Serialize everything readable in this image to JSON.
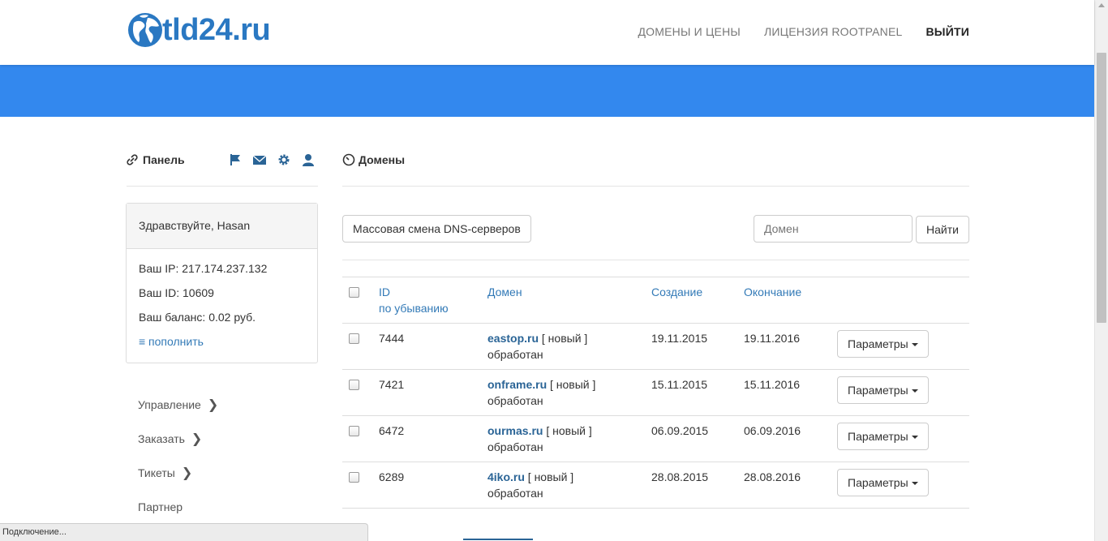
{
  "header": {
    "logo_text": "tld24.ru",
    "nav": [
      {
        "label": "ДОМЕНЫ И ЦЕНЫ",
        "active": false
      },
      {
        "label": "ЛИЦЕНЗИЯ ROOTPANEL",
        "active": false
      },
      {
        "label": "ВЫЙТИ",
        "active": true
      }
    ]
  },
  "colors": {
    "hero": "#3388ee",
    "brand": "#2a78c2",
    "link": "#337ab7"
  },
  "panel": {
    "title": "Панель",
    "icons": [
      "flag-icon",
      "envelope-icon",
      "gear-icon",
      "user-icon"
    ],
    "welcome": "Здравствуйте, Hasan",
    "ip": "Ваш IP: 217.174.237.132",
    "id": "Ваш ID: 10609",
    "balance": "Ваш баланс: 0.02 руб.",
    "topup": "≡ пополнить",
    "menu": [
      {
        "label": "Управление",
        "chevron": true
      },
      {
        "label": "Заказать",
        "chevron": true
      },
      {
        "label": "Тикеты",
        "chevron": true
      },
      {
        "label": "Партнер",
        "chevron": false
      }
    ]
  },
  "main": {
    "title": "Домены",
    "mass_dns_button": "Массовая смена DNS-серверов",
    "search": {
      "placeholder": "Домен",
      "button": "Найти"
    },
    "table": {
      "headers": {
        "id": "ID",
        "id_sort": "по убыванию",
        "domain": "Домен",
        "created": "Создание",
        "expires": "Окончание"
      },
      "rows": [
        {
          "id": "7444",
          "domain": "eastop.ru",
          "status": " [ новый ]",
          "state": "обработан",
          "created": "19.11.2015",
          "expires": "19.11.2016",
          "action": "Параметры"
        },
        {
          "id": "7421",
          "domain": "onframe.ru",
          "status": " [ новый ]",
          "state": "обработан",
          "created": "15.11.2015",
          "expires": "15.11.2016",
          "action": "Параметры"
        },
        {
          "id": "6472",
          "domain": "ourmas.ru",
          "status": " [ новый ]",
          "state": "обработан",
          "created": "06.09.2015",
          "expires": "06.09.2016",
          "action": "Параметры"
        },
        {
          "id": "6289",
          "domain": "4iko.ru",
          "status": " [ новый ]",
          "state": "обработан",
          "created": "28.08.2015",
          "expires": "28.08.2016",
          "action": "Параметры"
        }
      ]
    }
  },
  "statusbar": {
    "text": "Подключение..."
  }
}
